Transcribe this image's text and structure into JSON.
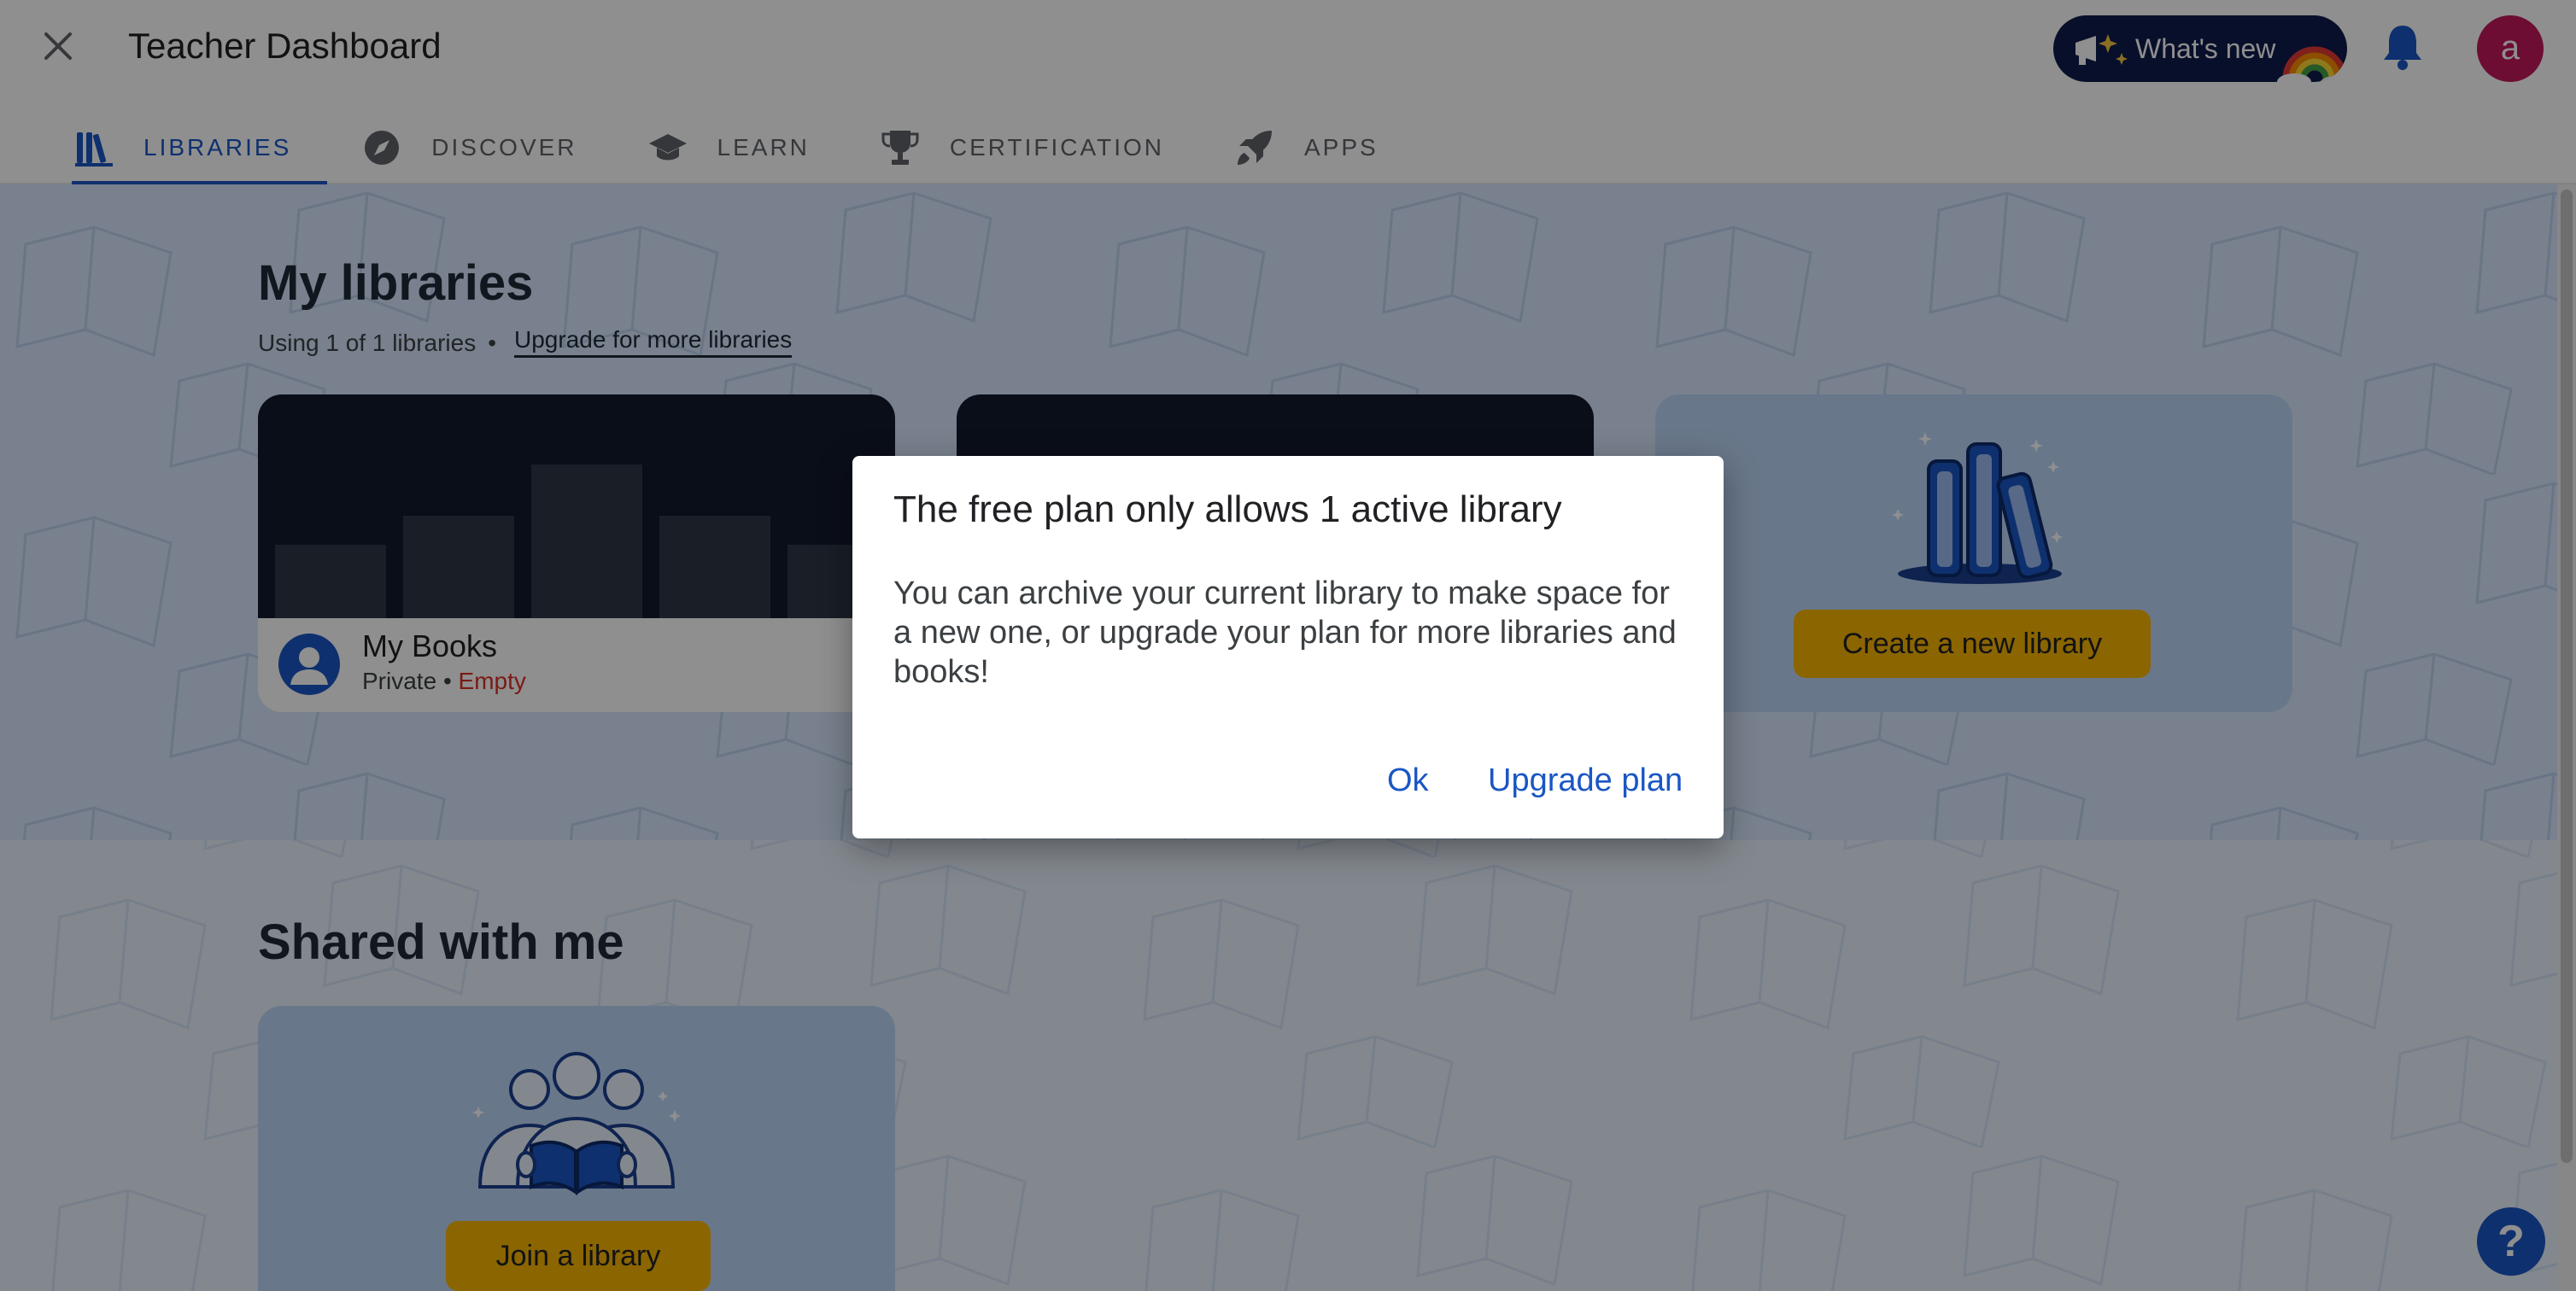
{
  "header": {
    "title": "Teacher Dashboard",
    "whats_new_label": "What's new",
    "avatar_letter": "a"
  },
  "tabs": [
    {
      "label": "LIBRARIES",
      "icon": "libraries-icon",
      "active": true
    },
    {
      "label": "DISCOVER",
      "icon": "compass-icon",
      "active": false
    },
    {
      "label": "LEARN",
      "icon": "graduation-cap-icon",
      "active": false
    },
    {
      "label": "CERTIFICATION",
      "icon": "trophy-icon",
      "active": false
    },
    {
      "label": "APPS",
      "icon": "rocket-icon",
      "active": false
    }
  ],
  "my_libraries": {
    "title": "My libraries",
    "usage_text": "Using 1 of 1 libraries",
    "separator": "•",
    "upgrade_link": "Upgrade for more libraries",
    "library": {
      "name": "My Books",
      "visibility": "Private",
      "separator": "•",
      "status": "Empty"
    },
    "create_button": "Create a new library"
  },
  "shared": {
    "title": "Shared with me",
    "join_button": "Join a library"
  },
  "help_label": "?",
  "dialog": {
    "title": "The free plan only allows 1 active library",
    "body": "You can archive your current library to make space for a new one, or upgrade your plan for more libraries and books!",
    "ok_label": "Ok",
    "upgrade_label": "Upgrade plan"
  },
  "colors": {
    "accent": "#1a56c4",
    "button_yellow": "#f6b400",
    "avatar": "#c2185b",
    "status_empty": "#d93025",
    "overlay": "rgba(0,0,0,0.44)"
  }
}
